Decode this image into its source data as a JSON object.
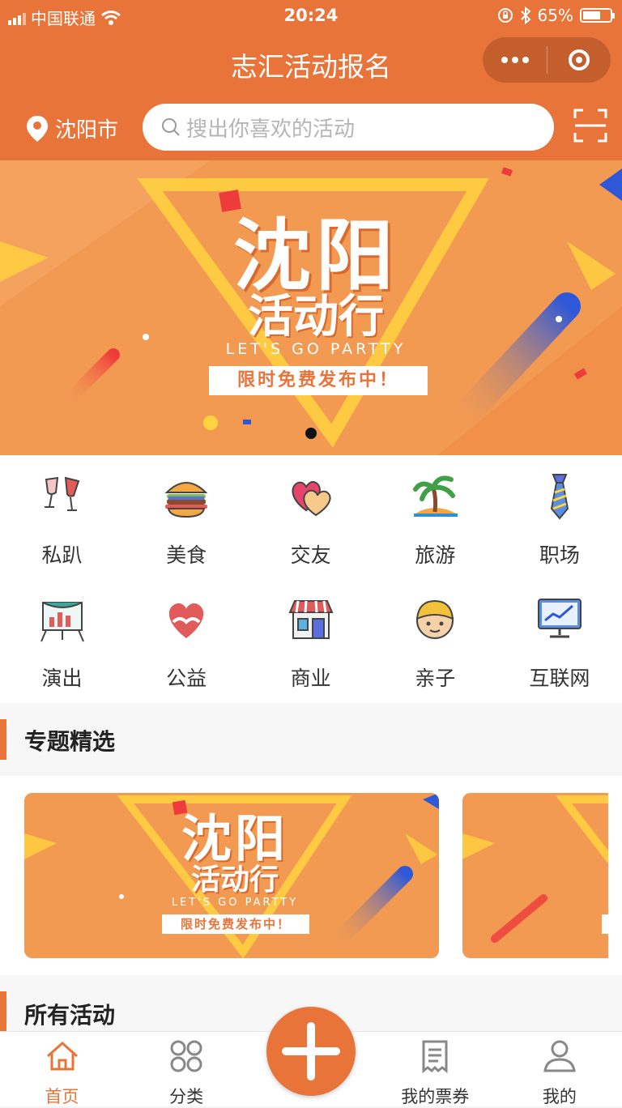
{
  "status_bar": {
    "carrier": "中国联通",
    "time": "20:24",
    "battery": "65%",
    "battery_level": 0.65
  },
  "nav": {
    "title": "志汇活动报名"
  },
  "search": {
    "city": "沈阳市",
    "placeholder": "搜出你喜欢的活动"
  },
  "banner": {
    "title_line1": "沈阳",
    "title_line2": "活动行",
    "subtitle": "LET'S GO PARTTY",
    "tag": "限时免费发布中！"
  },
  "categories": [
    {
      "label": "私趴",
      "icon": "wine-glasses-icon"
    },
    {
      "label": "美食",
      "icon": "burger-icon"
    },
    {
      "label": "交友",
      "icon": "hearts-icon"
    },
    {
      "label": "旅游",
      "icon": "palm-tree-icon"
    },
    {
      "label": "职场",
      "icon": "tie-icon"
    },
    {
      "label": "演出",
      "icon": "stage-icon"
    },
    {
      "label": "公益",
      "icon": "charity-heart-icon"
    },
    {
      "label": "商业",
      "icon": "shop-icon"
    },
    {
      "label": "亲子",
      "icon": "kid-face-icon"
    },
    {
      "label": "互联网",
      "icon": "monitor-chart-icon"
    }
  ],
  "sections": {
    "featured": "专题精选",
    "all": "所有活动"
  },
  "tabbar": [
    {
      "label": "首页",
      "icon": "home-icon",
      "active": true
    },
    {
      "label": "分类",
      "icon": "grid-icon",
      "active": false
    },
    {
      "label": "",
      "icon": "plus-icon",
      "active": false
    },
    {
      "label": "我的票券",
      "icon": "ticket-icon",
      "active": false
    },
    {
      "label": "我的",
      "icon": "user-icon",
      "active": false
    }
  ],
  "colors": {
    "brand": "#e9743a",
    "banner_bg": "#f29a52",
    "accent_blue": "#2f58d8",
    "accent_yellow": "#ffd23f"
  }
}
